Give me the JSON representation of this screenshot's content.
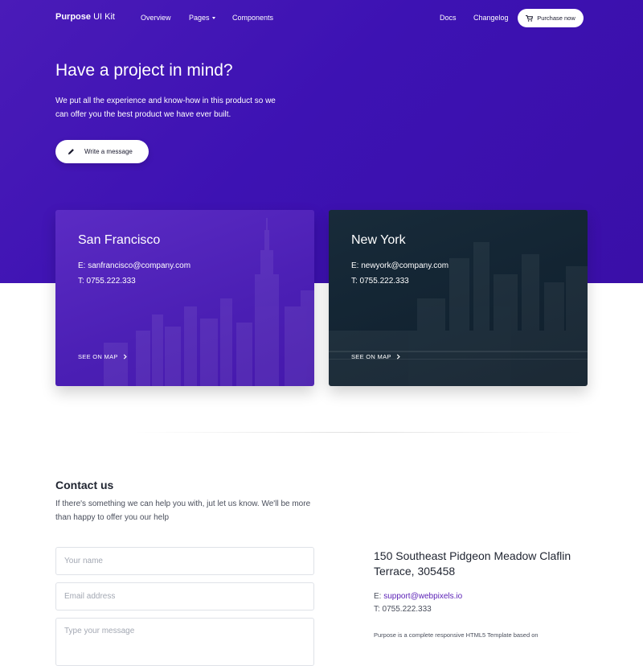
{
  "nav": {
    "brand_bold": "Purpose",
    "brand_rest": " UI Kit",
    "links": [
      "Overview",
      "Pages",
      "Components"
    ],
    "right_links": [
      "Docs",
      "Changelog"
    ],
    "purchase_label": "Purchase now"
  },
  "hero": {
    "title": "Have a project in mind?",
    "subtitle": "We put all the experience and know-how in this product so we can offer you the best product we have ever built.",
    "cta_label": "Write a message"
  },
  "offices": [
    {
      "city": "San Francisco",
      "email": "E: sanfrancisco@company.com",
      "phone": "T: 0755.222.333",
      "map_label": "SEE ON MAP"
    },
    {
      "city": "New York",
      "email": "E: newyork@company.com",
      "phone": "T: 0755.222.333",
      "map_label": "SEE ON MAP"
    }
  ],
  "contact": {
    "title": "Contact us",
    "description": "If there's something we can help you with, jut let us know. We'll be more than happy to offer you our help",
    "name_placeholder": "Your name",
    "email_placeholder": "Email address",
    "message_placeholder": "Type your message"
  },
  "address": {
    "street": "150 Southeast Pidgeon Meadow Claflin Terrace, 305458",
    "email_prefix": "E: ",
    "email": "support@webpixels.io",
    "phone": "T: 0755.222.333",
    "note": "Purpose is a complete responsive HTML5 Template based on"
  },
  "colors": {
    "primary": "#3d12b3",
    "ny_card": "#122331",
    "link": "#5b21b6"
  }
}
